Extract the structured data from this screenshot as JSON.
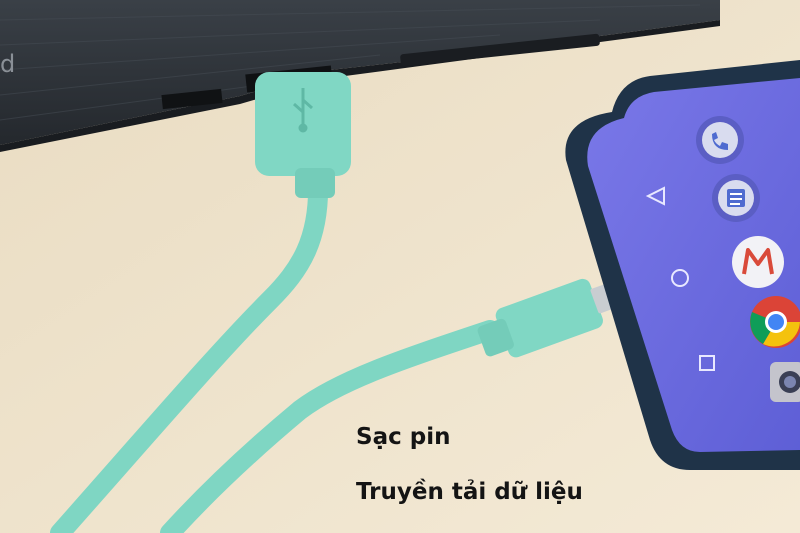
{
  "captions": {
    "charging": "Sạc pin",
    "data_transfer": "Truyền tải dữ liệu"
  },
  "scene": {
    "background_color": "#efe3cb",
    "laptop_color": "#2b3036",
    "cable_color": "#7fd6c3",
    "phone_screen_color": "#6f6ee0",
    "phone_body_color": "#1f3348"
  },
  "phone": {
    "nav_icons": [
      "back-triangle-icon",
      "home-circle-icon",
      "recents-square-icon"
    ],
    "app_icons": [
      "phone-app-icon",
      "messages-app-icon",
      "gmail-app-icon",
      "chrome-app-icon",
      "camera-app-icon"
    ]
  },
  "laptop": {
    "brand_fragment": "d"
  }
}
